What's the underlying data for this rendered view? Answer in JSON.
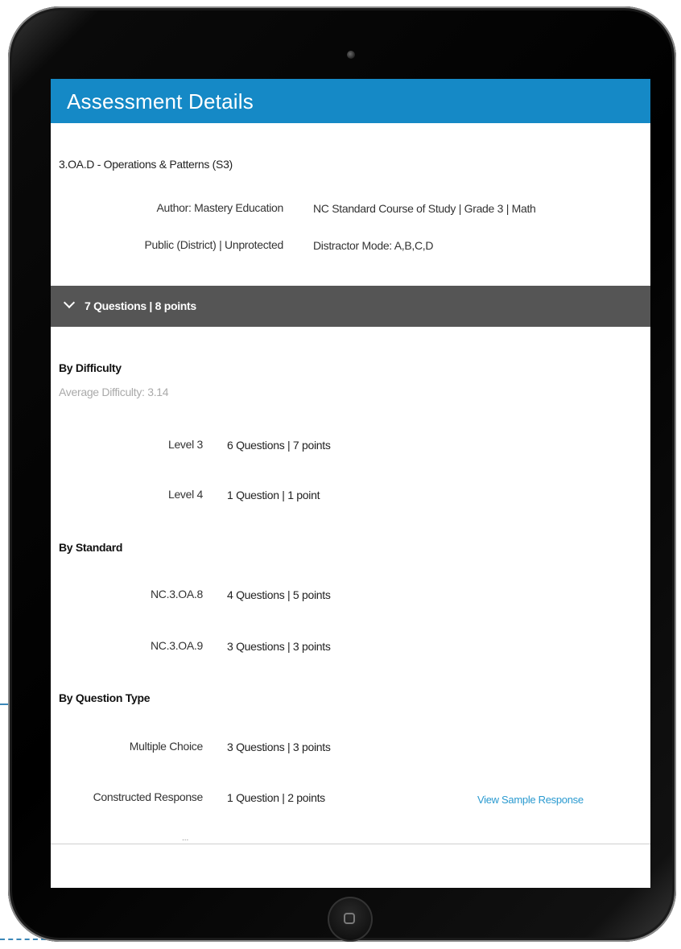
{
  "header": {
    "title": "Assessment Details"
  },
  "assessment": {
    "name": "3.OA.D - Operations & Patterns (S3)",
    "author": "Author: Mastery Education",
    "standard_course": "NC Standard Course of Study | Grade 3 | Math",
    "visibility": "Public (District) | Unprotected",
    "distractor_mode": "Distractor Mode: A,B,C,D"
  },
  "summary": {
    "label": "7 Questions | 8 points",
    "expanded": true
  },
  "by_difficulty": {
    "heading": "By Difficulty",
    "average": "Average Difficulty: 3.14",
    "rows": [
      {
        "label": "Level 3",
        "value": "6 Questions | 7 points"
      },
      {
        "label": "Level 4",
        "value": "1 Question | 1 point"
      }
    ]
  },
  "by_standard": {
    "heading": "By Standard",
    "rows": [
      {
        "label": "NC.3.OA.8",
        "value": "4 Questions | 5 points"
      },
      {
        "label": "NC.3.OA.9",
        "value": "3 Questions | 3 points"
      }
    ]
  },
  "by_question_type": {
    "heading": "By Question Type",
    "rows": [
      {
        "label": "Multiple Choice",
        "value": "3 Questions | 3 points"
      },
      {
        "label": "Constructed Response",
        "value": "1 Question | 2 points",
        "link": "View Sample Response"
      }
    ]
  },
  "truncated_marker": "...",
  "colors": {
    "title_bar": "#1589c6",
    "summary_bar": "#555555",
    "link": "#2a9ad0"
  },
  "icons": {
    "summary_toggle": "chevron-down-icon",
    "home": "home-button-icon"
  }
}
